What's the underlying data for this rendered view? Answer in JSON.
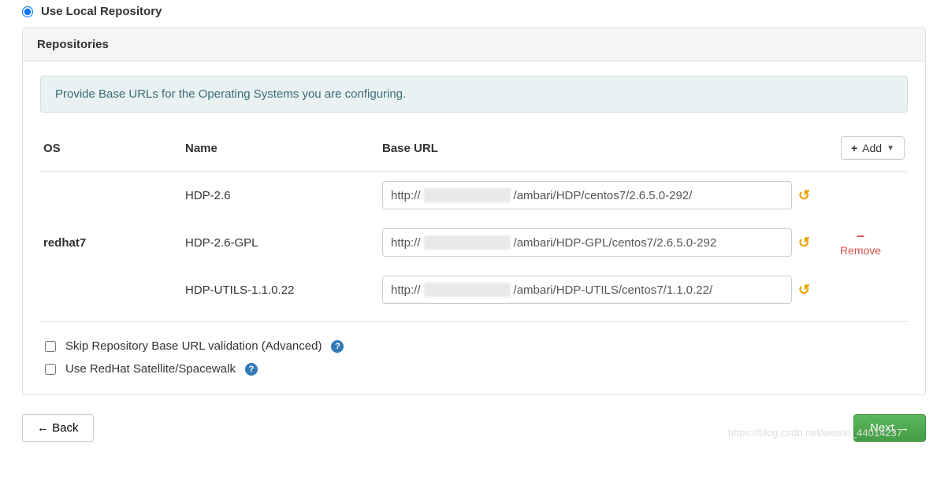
{
  "radio": {
    "label": "Use Local Repository",
    "checked": true
  },
  "panel": {
    "title": "Repositories"
  },
  "banner": "Provide Base URLs for the Operating Systems you are configuring.",
  "headers": {
    "os": "OS",
    "name": "Name",
    "url": "Base URL",
    "add": "Add"
  },
  "os": "redhat7",
  "repos": [
    {
      "name": "HDP-2.6",
      "prefix": "http://",
      "rest": "/ambari/HDP/centos7/2.6.5.0-292/"
    },
    {
      "name": "HDP-2.6-GPL",
      "prefix": "http://",
      "rest": "/ambari/HDP-GPL/centos7/2.6.5.0-292"
    },
    {
      "name": "HDP-UTILS-1.1.0.22",
      "prefix": "http://",
      "rest": "/ambari/HDP-UTILS/centos7/1.1.0.22/"
    }
  ],
  "remove": "Remove",
  "options": {
    "skip": "Skip Repository Base URL validation (Advanced)",
    "satellite": "Use RedHat Satellite/Spacewalk"
  },
  "footer": {
    "back": "← Back",
    "next": "Next →"
  },
  "watermark": "https://blog.csdn.net/weixin_44014237"
}
